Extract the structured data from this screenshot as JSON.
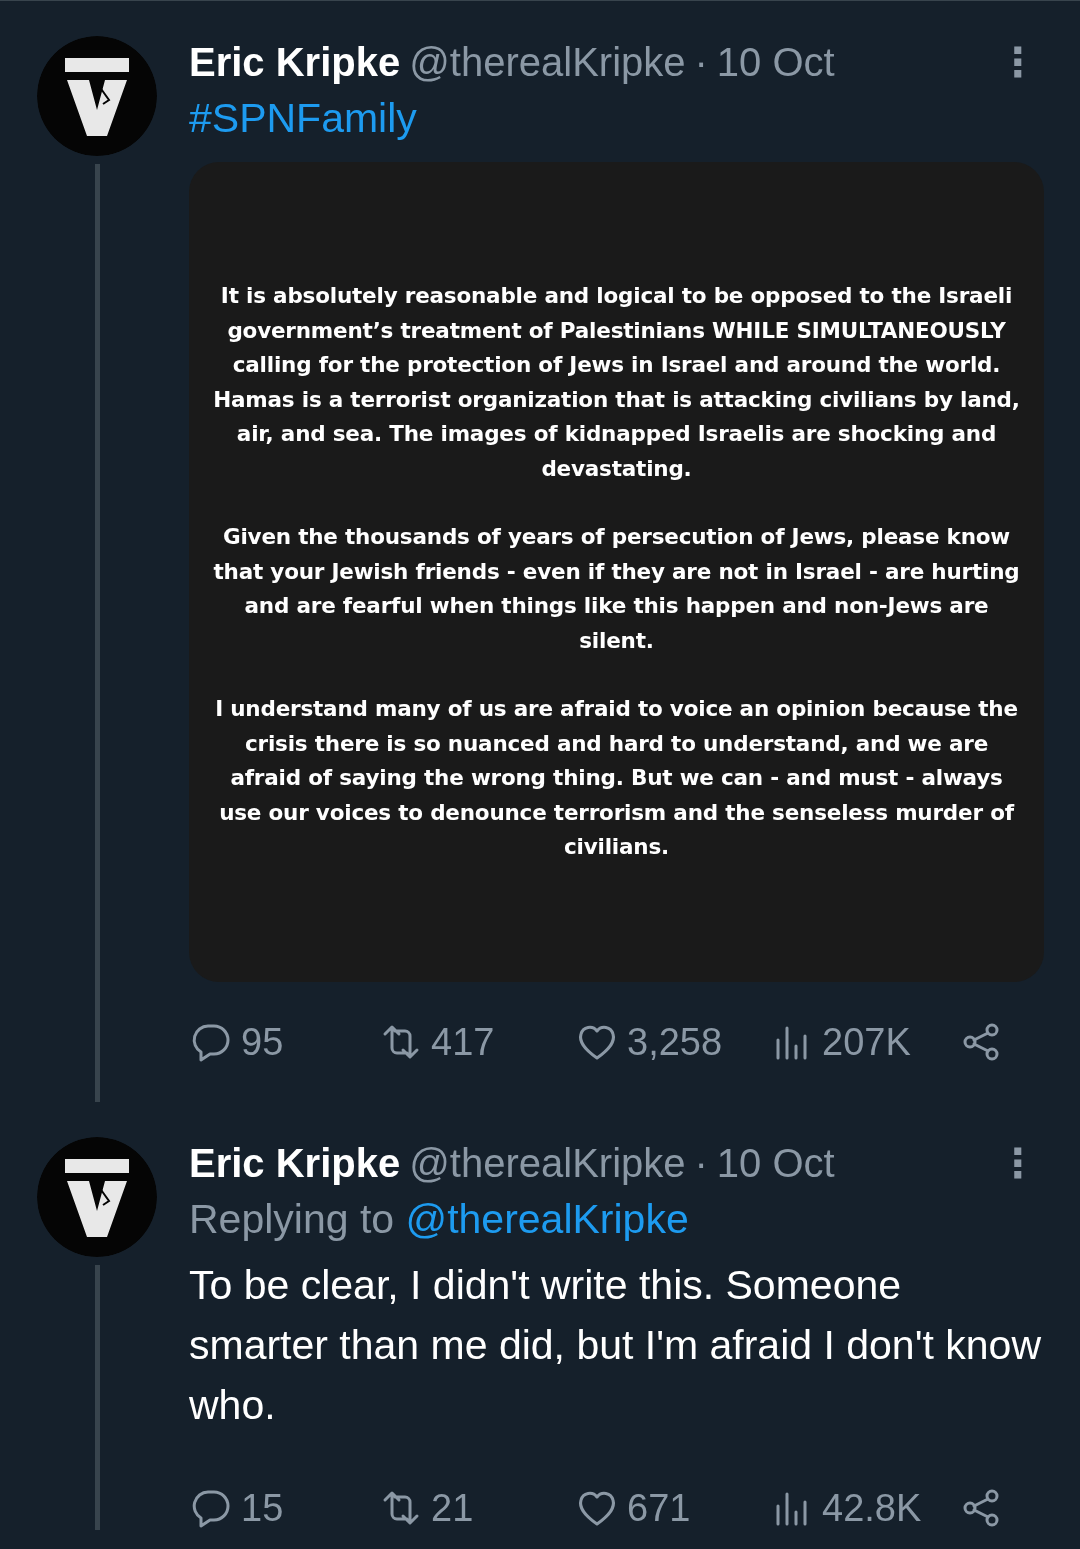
{
  "tweets": [
    {
      "name": "Eric Kripke",
      "handle": "@therealKripke",
      "separator": "·",
      "time": "10 Oct",
      "more": "⋮",
      "thread_line": true,
      "hashtag": "#SPNFamily",
      "image_paragraphs": [
        "It is absolutely reasonable and logical to be opposed to the Israeli government’s treatment of Palestinians WHILE SIMULTANEOUSLY calling for the protection of Jews in Israel and around the world. Hamas is a terrorist organization that is attacking civilians by land, air, and sea. The images of kidnapped Israelis are shocking and devastating.",
        "Given the thousands of years of persecution of Jews, please know that your Jewish friends - even if they are not in Israel - are hurting and are fearful when things like this happen and non-Jews are silent.",
        "I understand many of us are afraid to voice an opinion because the crisis there is so nuanced and hard to understand, and we are afraid of saying the wrong thing. But we can - and must - always use our voices to denounce terrorism and the senseless murder of civilians."
      ],
      "stats": {
        "replies": "95",
        "reposts": "417",
        "likes": "3,258",
        "views": "207K"
      }
    },
    {
      "name": "Eric Kripke",
      "handle": "@therealKripke",
      "separator": "·",
      "time": "10 Oct",
      "more": "⋮",
      "thread_line": true,
      "replying_label": "Replying to",
      "replying_handle": "@therealKripke",
      "text": "To be clear, I didn't write this. Someone smarter than me did, but I'm afraid I don't know who.",
      "stats": {
        "replies": "15",
        "reposts": "21",
        "likes": "671",
        "views": "42.8K"
      }
    }
  ]
}
